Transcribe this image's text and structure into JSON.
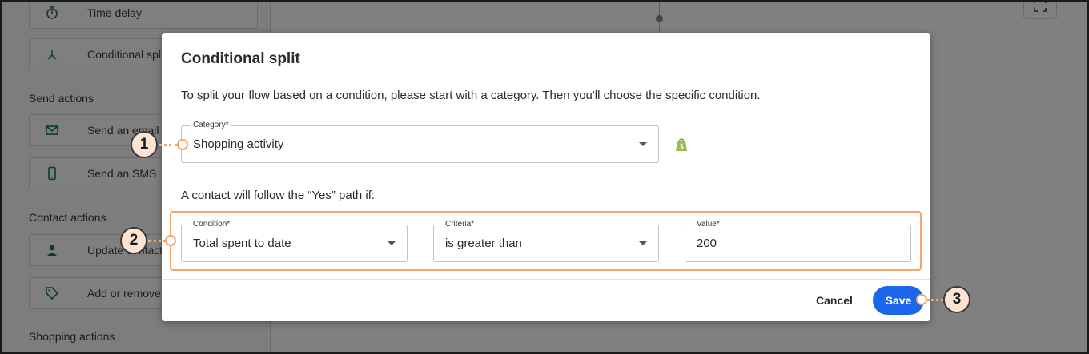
{
  "sidebar": {
    "items": [
      {
        "label": "Time delay",
        "icon": "stopwatch-icon"
      },
      {
        "label": "Conditional split",
        "icon": "split-icon"
      },
      {
        "label": "Send an email",
        "icon": "envelope-icon"
      },
      {
        "label": "Send an SMS",
        "icon": "phone-icon"
      },
      {
        "label": "Update contact",
        "icon": "person-icon"
      },
      {
        "label": "Add or remove tag",
        "icon": "tag-icon"
      }
    ],
    "sections": {
      "send_actions": "Send actions",
      "contact_actions": "Contact actions",
      "shopping_actions": "Shopping actions"
    }
  },
  "modal": {
    "title": "Conditional split",
    "description": "To split your flow based on a condition, please start with a category. Then you'll choose the specific condition.",
    "category": {
      "label": "Category*",
      "value": "Shopping activity",
      "badge_icon": "shopify-icon"
    },
    "follow_text": "A contact will follow the “Yes” path if:",
    "condition": {
      "label": "Condition*",
      "value": "Total spent to date"
    },
    "criteria": {
      "label": "Criteria*",
      "value": "is greater than"
    },
    "value": {
      "label": "Value*",
      "value": "200"
    },
    "cancel_label": "Cancel",
    "save_label": "Save"
  },
  "callouts": {
    "one": "1",
    "two": "2",
    "three": "3"
  },
  "colors": {
    "accent": "#1b66ea",
    "highlight": "#f4a46e",
    "callout_fill": "#fde4d2",
    "shopify_green": "#95bf47"
  }
}
